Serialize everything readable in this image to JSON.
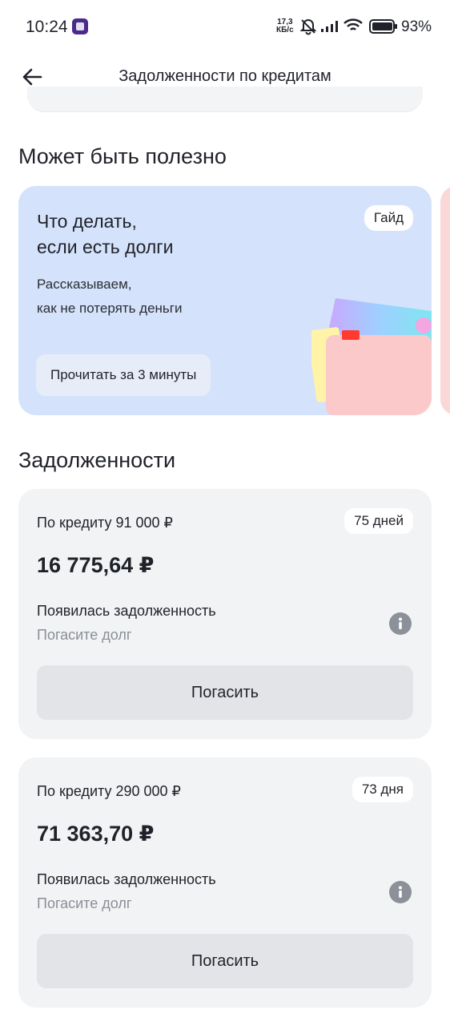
{
  "status_bar": {
    "time": "10:24",
    "speed_value": "17,3",
    "speed_unit": "КБ/с",
    "battery": "93%"
  },
  "header": {
    "title": "Задолженности по кредитам",
    "back_icon": "arrow-left-icon"
  },
  "useful_section": {
    "title": "Может быть полезно",
    "guide": {
      "title_line1": "Что делать,",
      "title_line2": "если есть долги",
      "badge": "Гайд",
      "desc_line1": "Рассказываем,",
      "desc_line2": "как не потерять деньги",
      "button": "Прочитать за 3 минуты",
      "accent": "#d4e2fb"
    }
  },
  "debts_section": {
    "title": "Задолженности",
    "items": [
      {
        "credit": "По кредиту 91 000 ₽",
        "days": "75 дней",
        "amount": "16 775,64 ₽",
        "status": "Появилась задолженность",
        "hint": "Погасите долг",
        "button": "Погасить"
      },
      {
        "credit": "По кредиту 290 000 ₽",
        "days": "73 дня",
        "amount": "71 363,70 ₽",
        "status": "Появилась задолженность",
        "hint": "Погасите долг",
        "button": "Погасить"
      }
    ]
  }
}
